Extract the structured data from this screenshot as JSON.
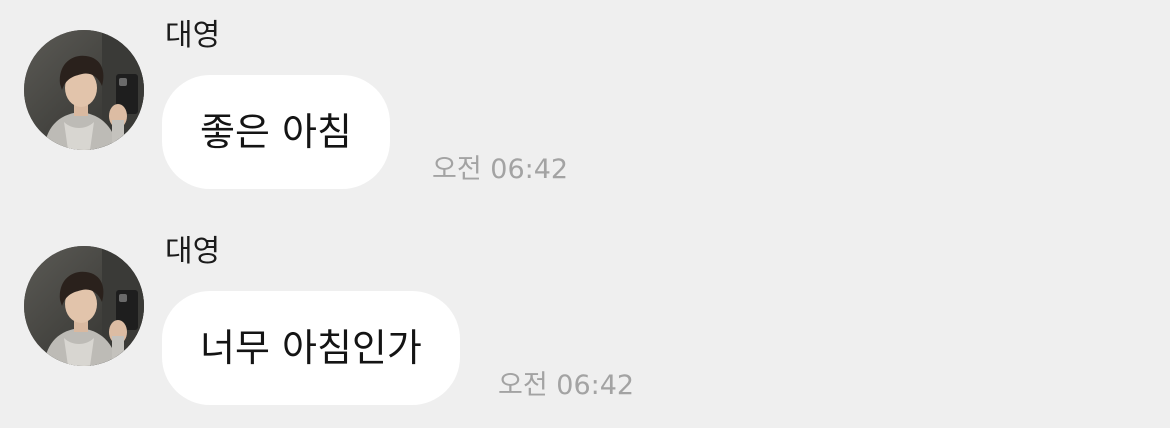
{
  "messages": [
    {
      "sender": "대영",
      "text": "좋은 아침",
      "time": "오전 06:42",
      "avatar_icon": "profile-photo-avatar"
    },
    {
      "sender": "대영",
      "text": "너무 아침인가",
      "time": "오전 06:42",
      "avatar_icon": "profile-photo-avatar"
    }
  ],
  "colors": {
    "background": "#efefef",
    "bubble": "#ffffff",
    "timestamp": "#a3a3a3",
    "text": "#141414"
  }
}
